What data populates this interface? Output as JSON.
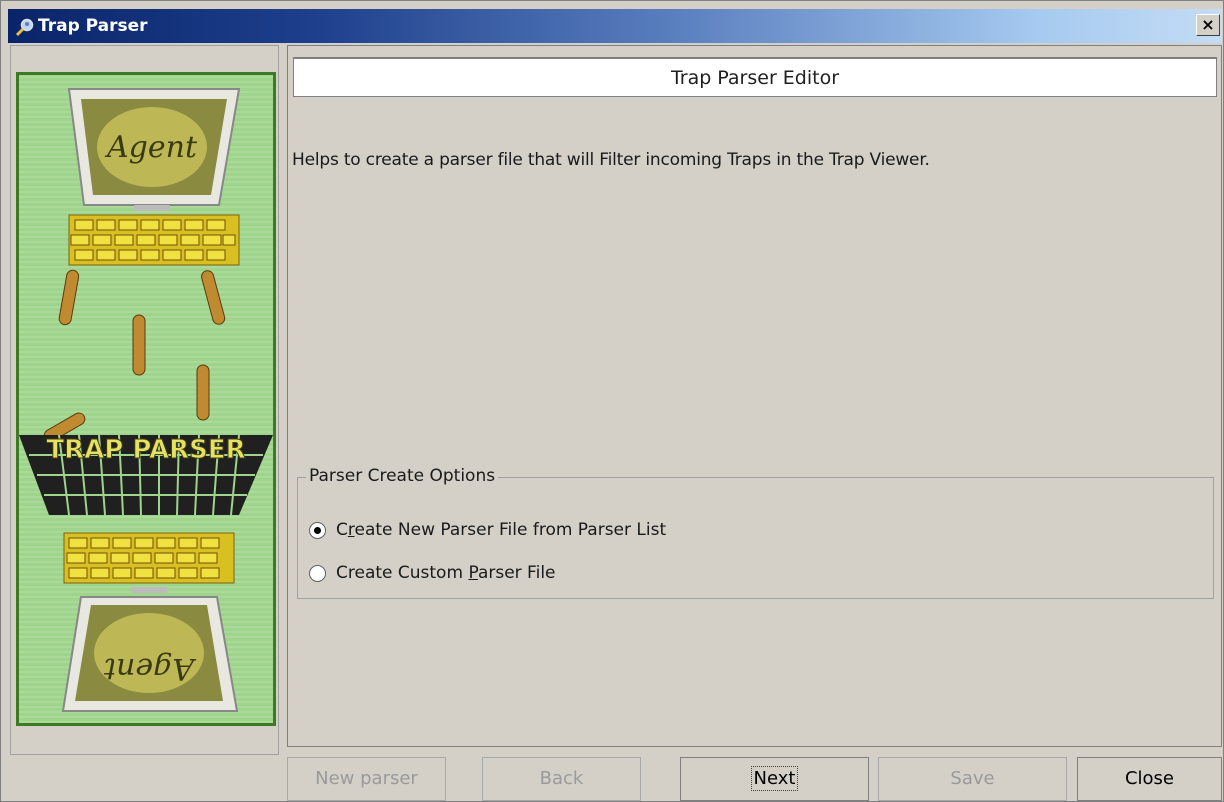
{
  "window": {
    "title": "Trap Parser",
    "close_symbol": "×"
  },
  "header": {
    "title": "Trap Parser Editor"
  },
  "description": "Helps to create a parser file that will Filter incoming Traps in the Trap Viewer.",
  "options_group": {
    "legend": "Parser Create Options",
    "options": [
      {
        "label_before": "C",
        "mnemonic": "r",
        "label_after": "eate New Parser File from Parser List",
        "selected": true
      },
      {
        "label_before": "Create Custom ",
        "mnemonic": "P",
        "label_after": "arser File",
        "selected": false
      }
    ]
  },
  "buttons": {
    "new_parser": "New parser",
    "back": "Back",
    "next": "Next",
    "save": "Save",
    "close": "Close"
  },
  "banner": {
    "top_screen_text": "Agent",
    "middle_text": "TRAP PARSER",
    "bottom_screen_text": "Agent",
    "colors": {
      "background": "#9fd48c",
      "border": "#3c7a25",
      "text": "#e8e060"
    }
  },
  "colors": {
    "title_bar_start": "#0a246a",
    "title_bar_end": "#c4dcf4",
    "panel_bg": "#d4d0c8"
  },
  "icons": {
    "title_icon": "magnifier-person-icon",
    "close_icon": "close-icon"
  }
}
